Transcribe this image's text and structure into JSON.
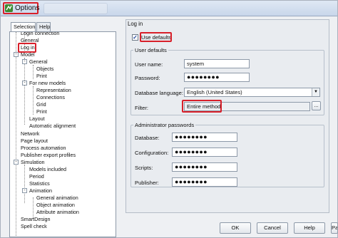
{
  "window": {
    "title": "Options",
    "accent_color": "#d8202a"
  },
  "left": {
    "tabs": [
      "Selection",
      "Help"
    ],
    "tree": [
      {
        "label": "Login connection",
        "level": 1
      },
      {
        "label": "General",
        "level": 1
      },
      {
        "label": "Log in",
        "level": 1,
        "selected": true
      },
      {
        "label": "Model",
        "level": 0,
        "expander": "-"
      },
      {
        "label": "General",
        "level": 1,
        "expander": "-"
      },
      {
        "label": "Objects",
        "level": 2
      },
      {
        "label": "Print",
        "level": 2
      },
      {
        "label": "For new models",
        "level": 1,
        "expander": "-"
      },
      {
        "label": "Representation",
        "level": 2
      },
      {
        "label": "Connections",
        "level": 2
      },
      {
        "label": "Grid",
        "level": 2
      },
      {
        "label": "Print",
        "level": 2
      },
      {
        "label": "Layout",
        "level": 1
      },
      {
        "label": "Automatic alignment",
        "level": 1
      },
      {
        "label": "Network",
        "level": 0
      },
      {
        "label": "Page layout",
        "level": 0
      },
      {
        "label": "Process automation",
        "level": 0
      },
      {
        "label": "Publisher export profiles",
        "level": 0
      },
      {
        "label": "Simulation",
        "level": 0,
        "expander": "-"
      },
      {
        "label": "Models included",
        "level": 1
      },
      {
        "label": "Period",
        "level": 1
      },
      {
        "label": "Statistics",
        "level": 1
      },
      {
        "label": "Animation",
        "level": 1,
        "expander": "-"
      },
      {
        "label": "General animation",
        "level": 2
      },
      {
        "label": "Object animation",
        "level": 2
      },
      {
        "label": "Attribute animation",
        "level": 2
      },
      {
        "label": "SmartDesign",
        "level": 0
      },
      {
        "label": "Spell check",
        "level": 0
      }
    ]
  },
  "right": {
    "section_title": "Log in",
    "use_defaults_label": "Use defaults",
    "use_defaults_checked": true,
    "user_defaults": {
      "group_label": "User defaults",
      "user_name_label": "User name:",
      "user_name_value": "system",
      "password_label": "Password:",
      "password_value": "●●●●●●●●",
      "db_language_label": "Database language:",
      "db_language_value": "English (United States)",
      "filter_label": "Filter:",
      "filter_value": "Entire method",
      "filter_button": "..."
    },
    "admin_passwords": {
      "group_label": "Administrator passwords",
      "database_label": "Database:",
      "database_value": "●●●●●●●●",
      "configuration_label": "Configuration:",
      "configuration_value": "●●●●●●●●",
      "scripts_label": "Scripts:",
      "scripts_value": "●●●●●●●●",
      "publisher_label": "Publisher:",
      "publisher_value": "●●●●●●●●"
    }
  },
  "footer": {
    "ok": "OK",
    "cancel": "Cancel",
    "help": "Help",
    "pass": "Pass"
  }
}
